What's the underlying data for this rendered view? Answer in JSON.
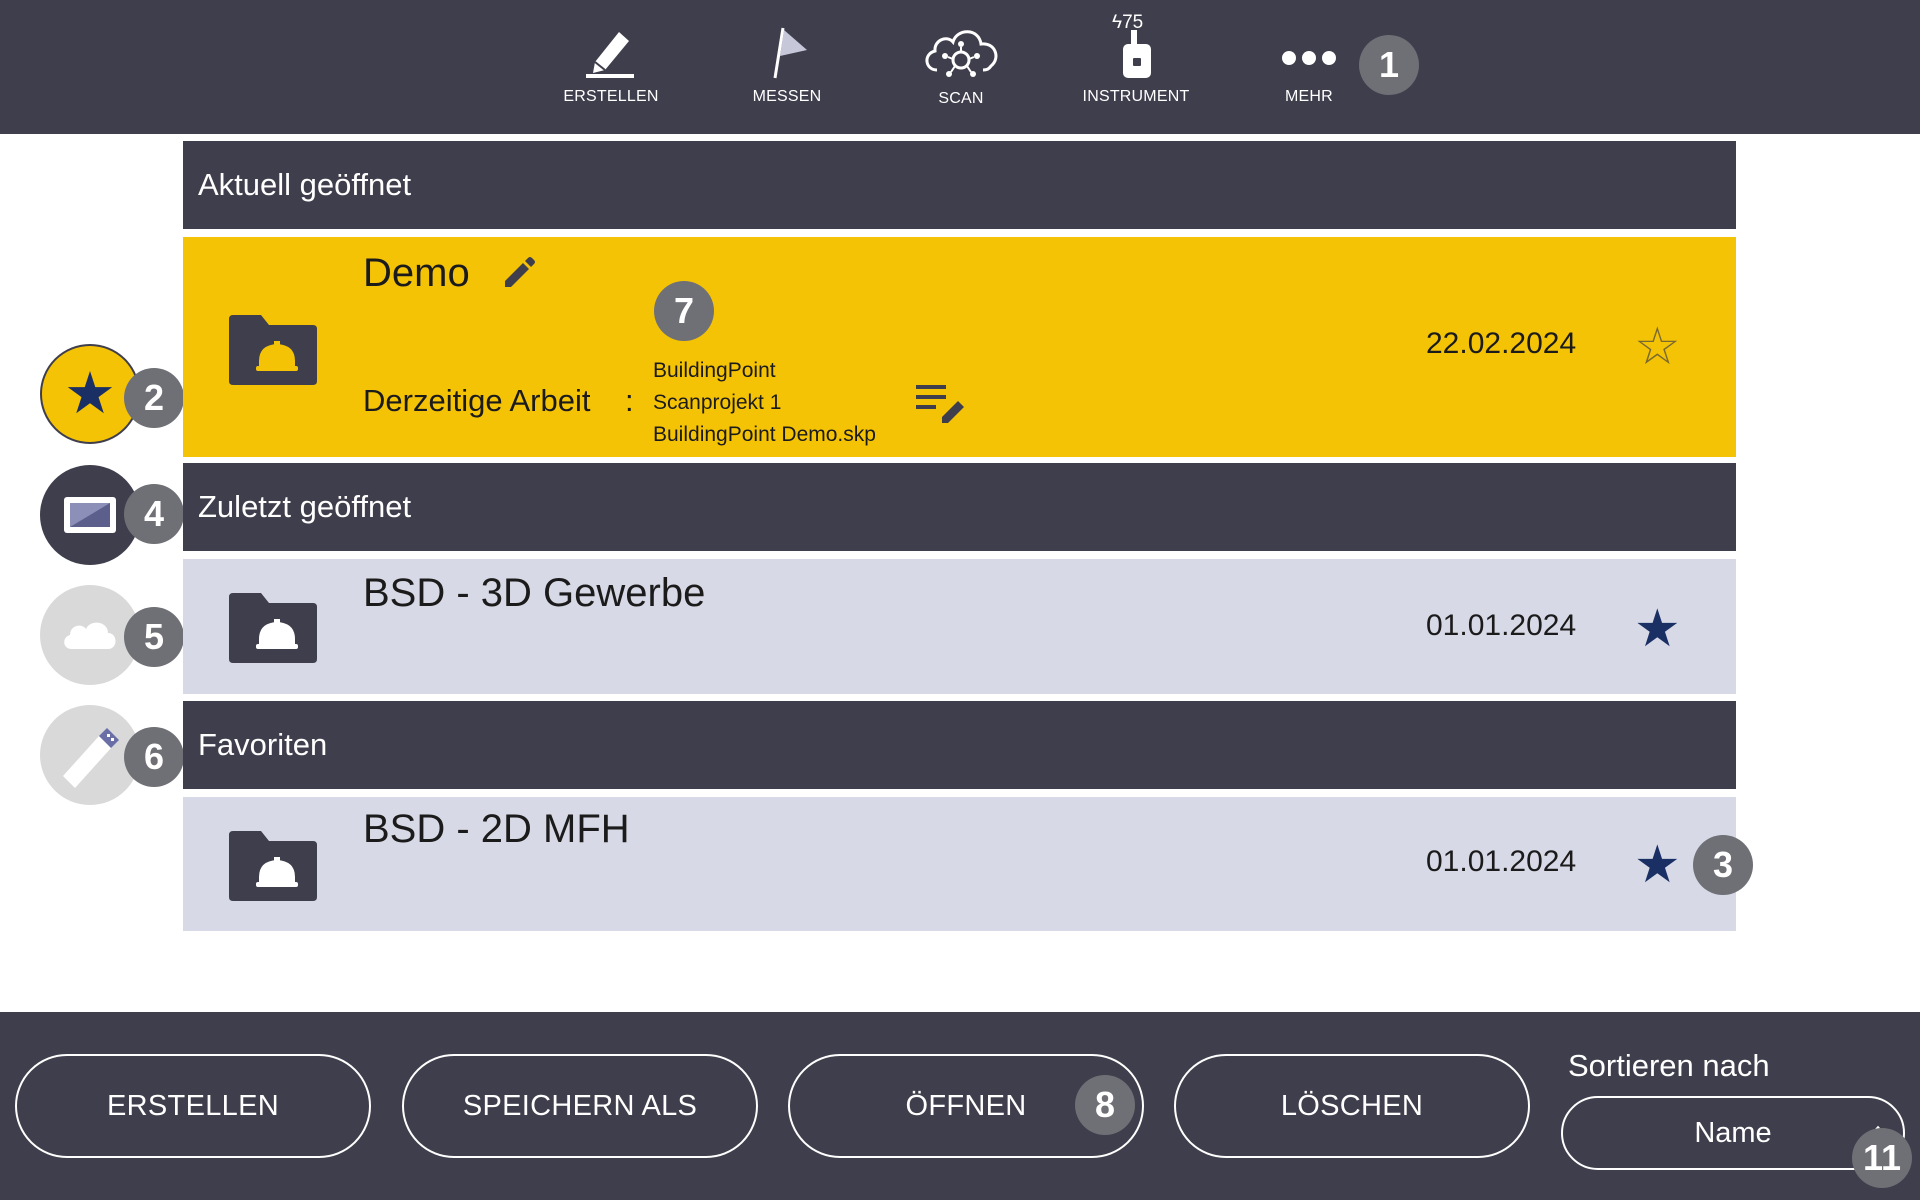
{
  "toolbar": {
    "items": [
      {
        "label": "ERSTELLEN",
        "icon": "pencil-icon"
      },
      {
        "label": "MESSEN",
        "icon": "flag-icon"
      },
      {
        "label": "SCAN",
        "icon": "cloud-scan-icon"
      },
      {
        "label": "INSTRUMENT",
        "icon": "instrument-icon"
      },
      {
        "label": "MEHR",
        "icon": "more-dots-icon"
      }
    ],
    "battery_level": "75"
  },
  "badges": {
    "b1": "1",
    "b2": "2",
    "b3": "3",
    "b4": "4",
    "b5": "5",
    "b6": "6",
    "b7": "7",
    "b8": "8",
    "b11": "11"
  },
  "sidebar": {
    "items": [
      {
        "name": "favorites",
        "icon": "star-icon",
        "active": true
      },
      {
        "name": "device",
        "icon": "tablet-icon",
        "active": false
      },
      {
        "name": "cloud",
        "icon": "cloud-icon",
        "active": false
      },
      {
        "name": "usb",
        "icon": "usb-drive-icon",
        "active": false
      }
    ]
  },
  "sections": {
    "current": {
      "title": "Aktuell geöffnet",
      "project": {
        "name": "Demo",
        "current_work_label": "Derzeitige Arbeit",
        "separator": ":",
        "work_lines": [
          "BuildingPoint",
          "Scanprojekt 1",
          "BuildingPoint Demo.skp"
        ],
        "date": "22.02.2024",
        "favorite": false,
        "star": "☆"
      }
    },
    "recent": {
      "title": "Zuletzt geöffnet",
      "project": {
        "name": "BSD - 3D Gewerbe",
        "date": "01.01.2024",
        "favorite": true,
        "star": "★"
      }
    },
    "favorites": {
      "title": "Favoriten",
      "project": {
        "name": "BSD - 2D MFH",
        "date": "01.01.2024",
        "favorite": true,
        "star": "★"
      }
    }
  },
  "actions": {
    "create": "ERSTELLEN",
    "save_as": "SPEICHERN ALS",
    "open": "ÖFFNEN",
    "delete": "LÖSCHEN"
  },
  "sort": {
    "label": "Sortieren nach",
    "value": "Name"
  },
  "colors": {
    "dark": "#3f3e4c",
    "accent_yellow": "#f5c306",
    "row_light": "#d7d9e6",
    "star_blue": "#1a2f63",
    "badge_gray": "#6f7076"
  }
}
